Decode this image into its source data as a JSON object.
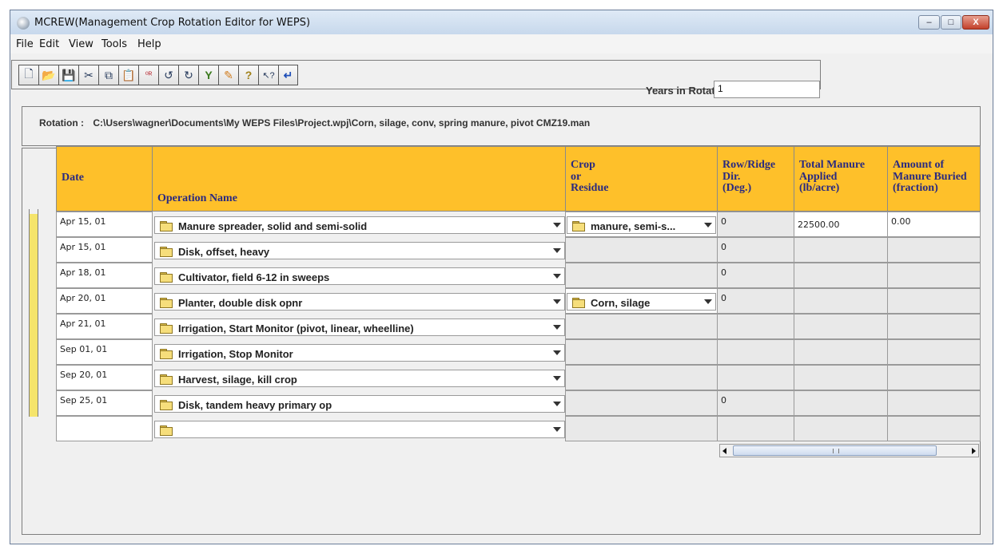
{
  "window": {
    "title": "MCREW(Management Crop Rotation Editor for WEPS)",
    "controls": {
      "minimize": "–",
      "maximize": "□",
      "close": "X"
    }
  },
  "menu": [
    {
      "label": "File"
    },
    {
      "label": "Edit"
    },
    {
      "label": "View"
    },
    {
      "label": "Tools"
    },
    {
      "label": "Help"
    }
  ],
  "toolbar": {
    "buttons": [
      {
        "icon": "new-file-icon",
        "glyph": "🗋"
      },
      {
        "icon": "open-folder-icon",
        "glyph": "📂"
      },
      {
        "icon": "save-icon",
        "glyph": "💾"
      },
      {
        "icon": "cut-icon",
        "glyph": "✂"
      },
      {
        "icon": "copy-icon",
        "glyph": "⧉"
      },
      {
        "icon": "paste-icon",
        "glyph": "📋"
      },
      {
        "icon": "insert-icon",
        "glyph": "⁰ᴿ"
      },
      {
        "icon": "undo-icon",
        "glyph": "↺"
      },
      {
        "icon": "redo-icon",
        "glyph": "↻"
      },
      {
        "icon": "filter-icon",
        "glyph": "Y"
      },
      {
        "icon": "edit-pencil-icon",
        "glyph": "✎"
      },
      {
        "icon": "help-icon",
        "glyph": "?"
      },
      {
        "icon": "context-help-icon",
        "glyph": "↖?"
      },
      {
        "icon": "return-arrow-icon",
        "glyph": "↵"
      }
    ],
    "years_label": "Years in Rotation:",
    "years_value": "1"
  },
  "rotation": {
    "label": "Rotation :",
    "path": "C:\\Users\\wagner\\Documents\\My WEPS Files\\Project.wpj\\Corn, silage, conv, spring manure, pivot CMZ19.man"
  },
  "table": {
    "headers": {
      "date": "Date",
      "operation": "Operation Name",
      "crop_line1": "Crop",
      "crop_line2": "or",
      "crop_line3": "Residue",
      "rowridge_line1": "Row/Ridge",
      "rowridge_line2": "Dir.",
      "rowridge_line3": "(Deg.)",
      "manure_line1": "Total Manure",
      "manure_line2": "Applied",
      "manure_line3": "(lb/acre)",
      "buried_line1": "Amount of",
      "buried_line2": "Manure Buried",
      "buried_line3": "(fraction)"
    },
    "rows": [
      {
        "date": "Apr 15, 01",
        "operation": "Manure spreader, solid and semi-solid",
        "crop": "manure, semi-s...",
        "rowridge": "0",
        "manure": "22500.00",
        "buried": "0.00"
      },
      {
        "date": "Apr 15, 01",
        "operation": "Disk, offset, heavy",
        "crop": "",
        "rowridge": "0",
        "manure": "",
        "buried": ""
      },
      {
        "date": "Apr 18, 01",
        "operation": "Cultivator, field 6-12 in sweeps",
        "crop": "",
        "rowridge": "0",
        "manure": "",
        "buried": ""
      },
      {
        "date": "Apr 20, 01",
        "operation": "Planter, double disk opnr",
        "crop": "Corn, silage",
        "rowridge": "0",
        "manure": "",
        "buried": ""
      },
      {
        "date": "Apr 21, 01",
        "operation": "Irrigation, Start Monitor (pivot, linear, wheelline)",
        "crop": "",
        "rowridge": "",
        "manure": "",
        "buried": ""
      },
      {
        "date": "Sep 01, 01",
        "operation": "Irrigation, Stop Monitor",
        "crop": "",
        "rowridge": "",
        "manure": "",
        "buried": ""
      },
      {
        "date": "Sep 20, 01",
        "operation": "Harvest, silage, kill crop",
        "crop": "",
        "rowridge": "",
        "manure": "",
        "buried": ""
      },
      {
        "date": "Sep 25, 01",
        "operation": "Disk, tandem heavy primary op",
        "crop": "",
        "rowridge": "0",
        "manure": "",
        "buried": ""
      },
      {
        "date": "",
        "operation": "",
        "crop": "",
        "rowridge": "",
        "manure": "",
        "buried": ""
      }
    ]
  },
  "colors": {
    "header_bg": "#fec02a",
    "header_text": "#2a2a80",
    "gutter_bar": "#f5e46b",
    "disabled_cell": "#e9e9e9"
  }
}
